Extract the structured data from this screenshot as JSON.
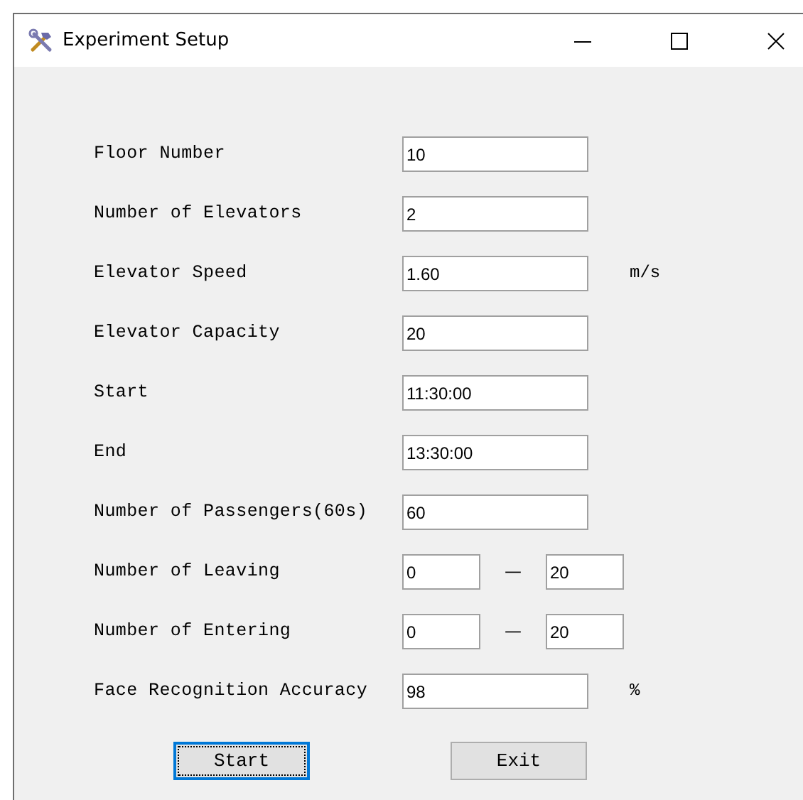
{
  "window": {
    "title": "Experiment Setup"
  },
  "rows": [
    {
      "kind": "single",
      "label": "Floor Number",
      "value": "10"
    },
    {
      "kind": "single",
      "label": "Number of Elevators",
      "value": "2"
    },
    {
      "kind": "single",
      "label": "Elevator Speed",
      "value": "1.60",
      "unit": "m/s"
    },
    {
      "kind": "single",
      "label": "Elevator Capacity",
      "value": "20"
    },
    {
      "kind": "single",
      "label": "Start",
      "value": "11:30:00"
    },
    {
      "kind": "single",
      "label": "End",
      "value": "13:30:00"
    },
    {
      "kind": "single",
      "label": "Number of Passengers(60s)",
      "value": "60"
    },
    {
      "kind": "range",
      "label": "Number of Leaving",
      "from": "0",
      "separator": "—",
      "to": "20"
    },
    {
      "kind": "range",
      "label": "Number of Entering",
      "from": "0",
      "separator": "—",
      "to": "20"
    },
    {
      "kind": "single",
      "label": "Face Recognition Accuracy",
      "value": "98",
      "unit": "%"
    }
  ],
  "buttons": [
    {
      "label": "Start",
      "focused": true
    },
    {
      "label": "Exit",
      "focused": false
    }
  ]
}
